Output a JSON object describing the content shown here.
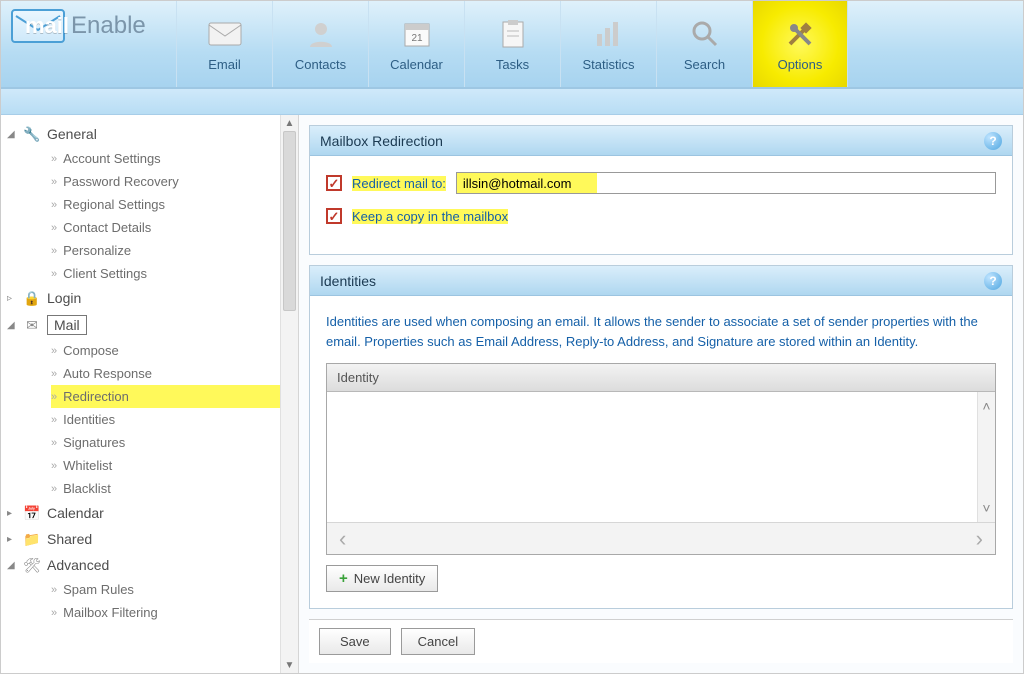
{
  "logo": {
    "mail": "mail",
    "enable": "Enable"
  },
  "nav": [
    {
      "label": "Email",
      "icon": "email"
    },
    {
      "label": "Contacts",
      "icon": "contacts"
    },
    {
      "label": "Calendar",
      "icon": "calendar"
    },
    {
      "label": "Tasks",
      "icon": "tasks"
    },
    {
      "label": "Statistics",
      "icon": "statistics"
    },
    {
      "label": "Search",
      "icon": "search"
    },
    {
      "label": "Options",
      "icon": "options",
      "active": true
    }
  ],
  "sidebar": {
    "general": {
      "label": "General",
      "items": [
        "Account Settings",
        "Password Recovery",
        "Regional Settings",
        "Contact Details",
        "Personalize",
        "Client Settings"
      ]
    },
    "login": {
      "label": "Login"
    },
    "mail": {
      "label": "Mail",
      "items": [
        "Compose",
        "Auto Response",
        "Redirection",
        "Identities",
        "Signatures",
        "Whitelist",
        "Blacklist"
      ],
      "highlighted": "Redirection"
    },
    "calendar": {
      "label": "Calendar"
    },
    "shared": {
      "label": "Shared"
    },
    "advanced": {
      "label": "Advanced",
      "items": [
        "Spam Rules",
        "Mailbox Filtering"
      ]
    }
  },
  "redirection": {
    "title": "Mailbox Redirection",
    "redirect_label": "Redirect mail to:",
    "redirect_value": "illsin@hotmail.com",
    "keepcopy_label": "Keep a copy in the mailbox"
  },
  "identities": {
    "title": "Identities",
    "description": "Identities are used when composing an email. It allows the sender to associate a set of sender properties with the email. Properties such as Email Address, Reply-to Address, and Signature are stored within an Identity.",
    "grid_header": "Identity",
    "new_button": "New Identity"
  },
  "buttons": {
    "save": "Save",
    "cancel": "Cancel"
  }
}
